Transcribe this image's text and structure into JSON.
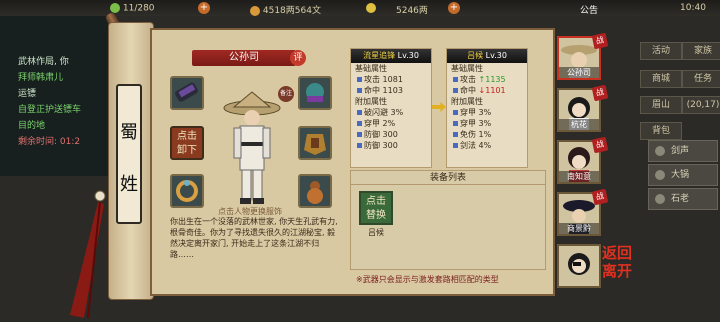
{
  "topbar": {
    "energy": "11/280",
    "coins": "4518两564文",
    "ingots": "5246两",
    "notice": "公告",
    "time": "10:40"
  },
  "quests": {
    "line1": "武林作局, 你",
    "line2": "拜师韩肃儿",
    "line3": "运镖",
    "line4": "自登正护送镖车",
    "line5": "目的地",
    "line6": "剩余时间: 01:2"
  },
  "right_menu": {
    "btn1": "活动",
    "btn2": "家族",
    "btn3": "商城",
    "btn4": "任务",
    "btn5": "眉山",
    "btn6": "(20,17)",
    "btn7": "背包",
    "btn8": "",
    "tab1": "剑声",
    "tab2": "大锅",
    "tab3": "石老"
  },
  "faction": [
    "蜀",
    "姓"
  ],
  "character": {
    "name": "公孙司",
    "rating_badge": "评",
    "equipped_label": "备注",
    "unequip_button": [
      "点击",
      "卸下"
    ],
    "hint": "点击人物更换服饰",
    "bio": "你出生在一个没落的武林世家, 你天生孔武有力, 根骨奇佳。你为了寻找遗失很久的江湖秘宝, 毅然决定离开家门, 开始走上了这条江湖不归路……"
  },
  "stats_left": {
    "header_name": "流星追锋",
    "header_level": "Lv.30",
    "base_title": "基础属性",
    "attack_label": "攻击",
    "attack_value": "1081",
    "hit_label": "命中",
    "hit_value": "1103",
    "extra_title": "附加属性",
    "r1_label": "破闪避",
    "r1_value": "3%",
    "r2_label": "穿甲",
    "r2_value": "2%",
    "r3_label": "防御",
    "r3_value": "300",
    "r4_label": "防御",
    "r4_value": "300"
  },
  "stats_right": {
    "header_name": "吕候",
    "header_level": "Lv.30",
    "base_title": "基础属性",
    "attack_label": "攻击",
    "attack_value": "1135",
    "hit_label": "命中",
    "hit_value": "1101",
    "extra_title": "附加属性",
    "r1_label": "穿甲",
    "r1_value": "3%",
    "r2_label": "穿甲",
    "r2_value": "3%",
    "r3_label": "免伤",
    "r3_value": "1%",
    "r4_label": "剑法",
    "r4_value": "4%"
  },
  "equip_list": {
    "title": "装备列表",
    "item_button": [
      "点击",
      "替换"
    ],
    "item_name": "吕候",
    "footnote": "※武器只会显示与激发套路相匹配的类型"
  },
  "roster": {
    "battle_tag": "战",
    "members": [
      "公孙司",
      "杭花",
      "南知意",
      "商景黔",
      ""
    ]
  },
  "leave_button": [
    "返回",
    "离开"
  ],
  "colors": {
    "scroll": "#d9c9a2",
    "name_plate": "#a02a22",
    "stat_up": "#2a9a2a",
    "stat_down": "#c02020",
    "action_green": "#3a6a3a",
    "action_red": "#8a3a1e"
  }
}
